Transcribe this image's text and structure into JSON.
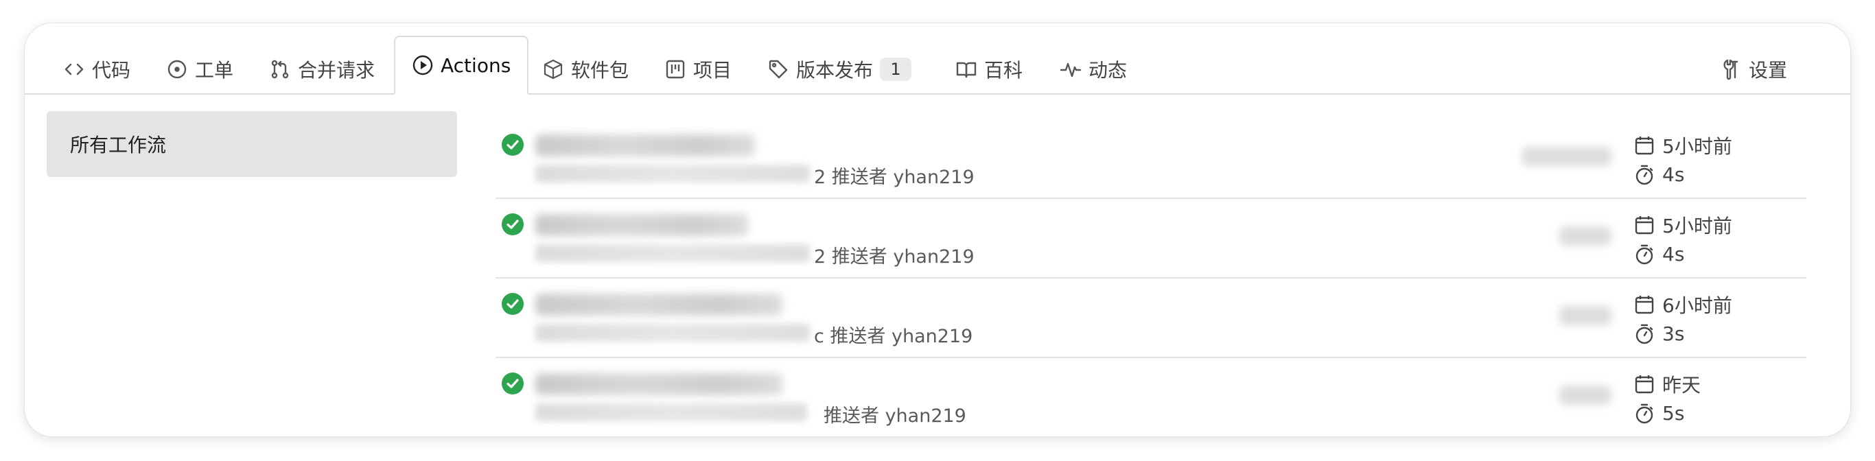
{
  "tabs": [
    {
      "label": "代码",
      "icon": "code-icon"
    },
    {
      "label": "工单",
      "icon": "issue-icon"
    },
    {
      "label": "合并请求",
      "icon": "pull-request-icon"
    },
    {
      "label": "Actions",
      "icon": "play-circle-icon",
      "active": true
    },
    {
      "label": "软件包",
      "icon": "package-icon"
    },
    {
      "label": "项目",
      "icon": "project-icon"
    },
    {
      "label": "版本发布",
      "icon": "tag-icon",
      "badge": "1"
    },
    {
      "label": "百科",
      "icon": "book-icon"
    },
    {
      "label": "动态",
      "icon": "pulse-icon"
    }
  ],
  "settings": {
    "label": "设置",
    "icon": "tools-icon"
  },
  "sidebar": {
    "items": [
      {
        "label": "所有工作流",
        "selected": true
      }
    ]
  },
  "runs": [
    {
      "status": "success",
      "meta_tail": "2 推送者 yhan219",
      "time_ago": "5小时前",
      "duration": "4s"
    },
    {
      "status": "success",
      "meta_tail": "2 推送者 yhan219",
      "time_ago": "5小时前",
      "duration": "4s"
    },
    {
      "status": "success",
      "meta_tail": "c 推送者 yhan219",
      "time_ago": "6小时前",
      "duration": "3s"
    },
    {
      "status": "success",
      "meta_tail": "推送者 yhan219",
      "time_ago": "昨天",
      "duration": "5s"
    }
  ],
  "colors": {
    "success": "#2da44e",
    "tab_border": "#dcdcdc",
    "sidebar_selected": "#e4e4e4"
  }
}
